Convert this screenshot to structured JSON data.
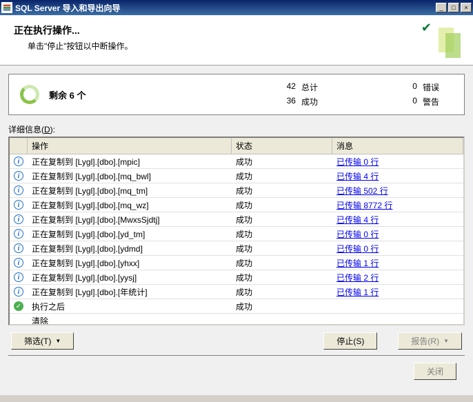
{
  "window": {
    "title": "SQL Server 导入和导出向导"
  },
  "header": {
    "title": "正在执行操作...",
    "subtitle": "单击\"停止\"按钮以中断操作。"
  },
  "summary": {
    "remaining_label": "剩余",
    "remaining_count": "6",
    "remaining_unit": "个",
    "total_num": "42",
    "total_label": "总计",
    "success_num": "36",
    "success_label": "成功",
    "error_num": "0",
    "error_label": "错误",
    "warn_num": "0",
    "warn_label": "警告"
  },
  "details_label_prefix": "详细信息(",
  "details_label_u": "D",
  "details_label_suffix": "):",
  "columns": {
    "operation": "操作",
    "status": "状态",
    "message": "消息"
  },
  "rows": [
    {
      "icon": "info",
      "op": "正在复制到 [Lygl].[dbo].[mpic]",
      "status": "成功",
      "msg": "已传输 0 行"
    },
    {
      "icon": "info",
      "op": "正在复制到 [Lygl].[dbo].[mq_bwl]",
      "status": "成功",
      "msg": "已传输 4 行"
    },
    {
      "icon": "info",
      "op": "正在复制到 [Lygl].[dbo].[mq_tm]",
      "status": "成功",
      "msg": "已传输 502 行"
    },
    {
      "icon": "info",
      "op": "正在复制到 [Lygl].[dbo].[mq_wz]",
      "status": "成功",
      "msg": "已传输 8772 行"
    },
    {
      "icon": "info",
      "op": "正在复制到 [Lygl].[dbo].[MwxsSjdtj]",
      "status": "成功",
      "msg": "已传输 4 行"
    },
    {
      "icon": "info",
      "op": "正在复制到 [Lygl].[dbo].[yd_tm]",
      "status": "成功",
      "msg": "已传输 0 行"
    },
    {
      "icon": "info",
      "op": "正在复制到 [Lygl].[dbo].[ydmd]",
      "status": "成功",
      "msg": "已传输 0 行"
    },
    {
      "icon": "info",
      "op": "正在复制到 [Lygl].[dbo].[yhxx]",
      "status": "成功",
      "msg": "已传输 1 行"
    },
    {
      "icon": "info",
      "op": "正在复制到 [Lygl].[dbo].[yysj]",
      "status": "成功",
      "msg": "已传输 2 行"
    },
    {
      "icon": "info",
      "op": "正在复制到 [Lygl].[dbo].[年统计]",
      "status": "成功",
      "msg": "已传输 1 行"
    },
    {
      "icon": "check",
      "op": "执行之后",
      "status": "成功",
      "msg": ""
    },
    {
      "icon": "",
      "op": "清除",
      "status": "",
      "msg": ""
    }
  ],
  "buttons": {
    "filter": "筛选(T)",
    "stop": "停止(S)",
    "report": "报告(R)",
    "close": "关闭"
  }
}
